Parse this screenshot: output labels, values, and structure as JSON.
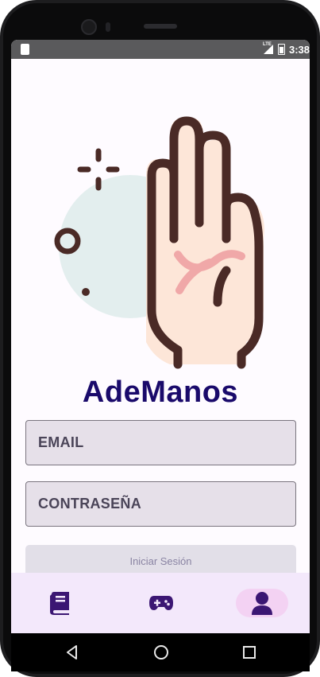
{
  "status_bar": {
    "network_label": "LTE",
    "time": "3:38"
  },
  "app": {
    "title": "AdeManos"
  },
  "login_form": {
    "email_placeholder": "EMAIL",
    "password_placeholder": "CONTRASEÑA",
    "submit_label": "Iniciar Sesión"
  },
  "bottom_nav": {
    "items": [
      {
        "icon": "book-icon",
        "selected": false
      },
      {
        "icon": "gamepad-icon",
        "selected": false
      },
      {
        "icon": "person-icon",
        "selected": true
      }
    ]
  },
  "colors": {
    "title": "#1a0a6b",
    "field_background": "#e6e0e9",
    "nav_background": "#f3e8fb",
    "nav_selected": "#f3d2f3",
    "icon": "#3b1673",
    "hand_outline": "#4a2a26",
    "hand_fill": "#fde6d8",
    "palm_lines": "#f0a8a8",
    "backdrop_circle": "#e3eeee"
  }
}
